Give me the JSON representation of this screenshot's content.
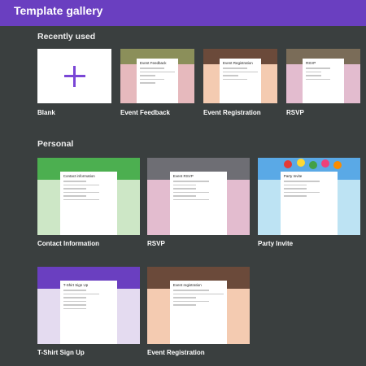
{
  "header": {
    "title": "Template gallery",
    "accent": "#6a3fc0"
  },
  "sections": {
    "recently_used": "Recently used",
    "personal": "Personal"
  },
  "recent": [
    {
      "label": "Blank",
      "icon": "plus-icon"
    },
    {
      "label": "Event Feedback",
      "form_title": "Event Feedback"
    },
    {
      "label": "Event Registration",
      "form_title": "Event Registration"
    },
    {
      "label": "RSVP",
      "form_title": "RSVP"
    }
  ],
  "personal": [
    {
      "label": "Contact Information",
      "form_title": "Contact information"
    },
    {
      "label": "RSVP",
      "form_title": "Event RSVP"
    },
    {
      "label": "Party Invite",
      "form_title": "Party Invite"
    },
    {
      "label": "T-Shirt Sign Up",
      "form_title": "T-Shirt Sign Up"
    },
    {
      "label": "Event Registration",
      "form_title": "Event registration"
    }
  ],
  "colors": {
    "background": "#3a3f3f",
    "blank_plus": "#7a46d6",
    "event_feedback_side": "#e6b9bd",
    "event_registration_side": "#f4cbb1",
    "rsvp_side": "#e3bccf",
    "contact_green": "#4caf50",
    "contact_light": "#cde7c6",
    "party_blue": "#bde3f3",
    "tshirt_purple": "#6a3fc0",
    "tshirt_light": "#e4dbf0"
  }
}
